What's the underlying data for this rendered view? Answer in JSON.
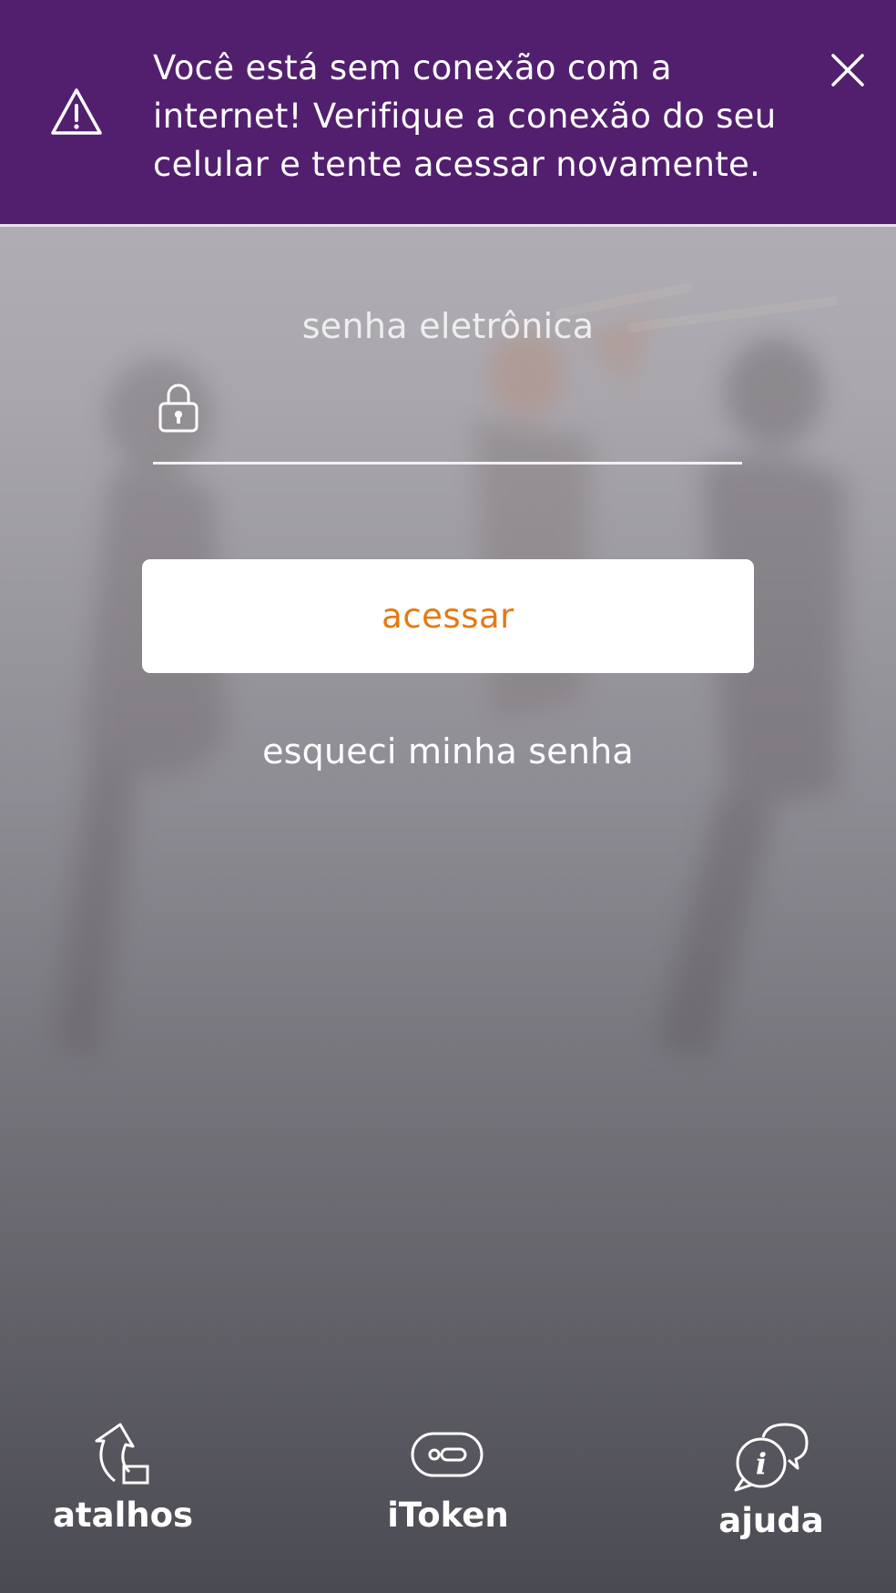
{
  "alert": {
    "message": "Você está sem conexão com a internet! Verifique a conexão do seu celular e tente acessar novamente.",
    "icon": "warning-triangle-icon",
    "close_icon": "close-icon",
    "background_color": "#521f6e"
  },
  "login": {
    "password_label": "senha eletrônica",
    "password_value": "",
    "lock_icon": "lock-icon",
    "access_button_label": "acessar",
    "access_button_text_color": "#e47a14",
    "forgot_password_label": "esqueci minha senha"
  },
  "bottom_nav": {
    "items": [
      {
        "label": "atalhos",
        "icon": "shortcut-arrow-icon"
      },
      {
        "label": "iToken",
        "icon": "token-icon"
      },
      {
        "label": "ajuda",
        "icon": "help-chat-icon"
      }
    ]
  }
}
